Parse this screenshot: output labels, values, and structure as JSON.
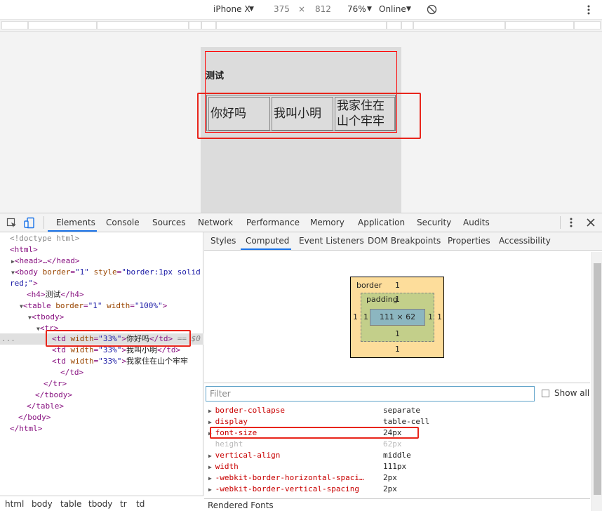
{
  "device_toolbar": {
    "device": "iPhone X",
    "width": "375",
    "times": "×",
    "height": "812",
    "zoom": "76%",
    "network": "Online"
  },
  "page": {
    "heading": "测试",
    "cells": [
      "你好吗",
      "我叫小明",
      "我家住在山个牢牢"
    ],
    "cell3_line1": "我家住在",
    "cell3_line2": "山个牢牢"
  },
  "devtools": {
    "tabs": [
      "Elements",
      "Console",
      "Sources",
      "Network",
      "Performance",
      "Memory",
      "Application",
      "Security",
      "Audits"
    ],
    "active_tab": "Elements",
    "dom": {
      "doctype": "<!doctype html>",
      "html_open": "<html>",
      "head": "<head>…</head>",
      "body_open_a": "<body",
      "body_attr1": "border",
      "body_val1": "\"1\"",
      "body_attr2": "style",
      "body_val2a": "\"border:1px solid",
      "body_val2b": "red;\"",
      "h4_open": "<h4>",
      "h4_text": "测试",
      "h4_close": "</h4>",
      "table_open": "<table",
      "table_attr1": "border",
      "table_val1": "\"1\"",
      "table_attr2": "width",
      "table_val2": "\"100%\"",
      "tbody_open": "<tbody>",
      "tr_open": "<tr>",
      "td_open": "<td",
      "td_attr": "width",
      "td_val": "\"33%\"",
      "td_close": "</td>",
      "td1_text": "你好吗",
      "td2_text": "我叫小明",
      "td3_text": "我家住在山个牢牢",
      "selected_marker": "== $0",
      "tr_close": "</tr>",
      "tbody_close": "</tbody>",
      "table_close": "</table>",
      "body_close": "</body>",
      "html_close": "</html>",
      "ellipsis": "..."
    },
    "breadcrumbs": [
      "html",
      "body",
      "table",
      "tbody",
      "tr",
      "td"
    ],
    "subtabs": [
      "Styles",
      "Computed",
      "Event Listeners",
      "DOM Breakpoints",
      "Properties",
      "Accessibility"
    ],
    "active_subtab": "Computed",
    "box_model": {
      "border_label": "border",
      "border_top": "1",
      "border_bottom": "1",
      "border_left": "1",
      "border_right": "1",
      "padding_label": "padding",
      "padding_top": "1",
      "padding_bottom": "1",
      "padding_left": "1",
      "padding_right": "1",
      "content": "111 × 62"
    },
    "filter_placeholder": "Filter",
    "show_all": "Show all",
    "computed": [
      {
        "name": "border-collapse",
        "value": "separate",
        "dim": false
      },
      {
        "name": "display",
        "value": "table-cell",
        "dim": false
      },
      {
        "name": "font-size",
        "value": "24px",
        "dim": false
      },
      {
        "name": "height",
        "value": "62px",
        "dim": true
      },
      {
        "name": "vertical-align",
        "value": "middle",
        "dim": false
      },
      {
        "name": "width",
        "value": "111px",
        "dim": false
      },
      {
        "name": "-webkit-border-horizontal-spaci…",
        "value": "2px",
        "dim": false
      },
      {
        "name": "-webkit-border-vertical-spacing",
        "value": "2px",
        "dim": false
      }
    ],
    "rendered_fonts": "Rendered Fonts"
  },
  "colors": {
    "highlight": "#e8251b",
    "active_tab_underline": "#1a73e8",
    "tag": "#881280",
    "attribute": "#994500",
    "attribute_value": "#1a1aa6"
  }
}
